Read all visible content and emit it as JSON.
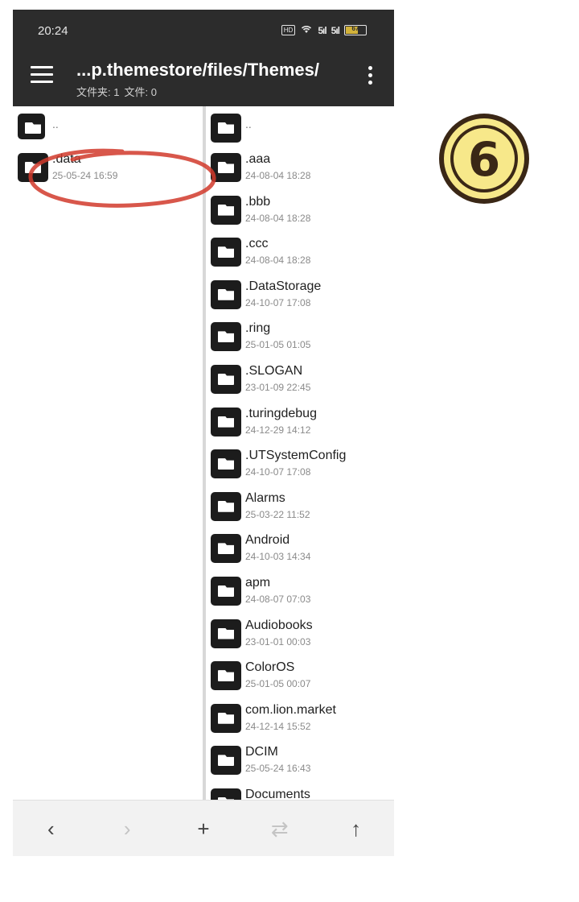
{
  "status_bar": {
    "time": "20:24",
    "hd_label": "HD",
    "wifi_icon": "wifi-icon",
    "signal_1": "5ıl",
    "signal_2": "5ıl",
    "battery_text": "67"
  },
  "toolbar": {
    "title": "...p.themestore/files/Themes/",
    "folders_label": "文件夹: 1",
    "files_label": "文件: 0"
  },
  "left_pane": {
    "items": [
      {
        "name": "..",
        "date": ""
      },
      {
        "name": ".data",
        "date": "25-05-24 16:59"
      }
    ]
  },
  "right_pane": {
    "items": [
      {
        "name": "..",
        "date": ""
      },
      {
        "name": ".aaa",
        "date": "24-08-04 18:28"
      },
      {
        "name": ".bbb",
        "date": "24-08-04 18:28"
      },
      {
        "name": ".ccc",
        "date": "24-08-04 18:28"
      },
      {
        "name": ".DataStorage",
        "date": "24-10-07 17:08"
      },
      {
        "name": ".ring",
        "date": "25-01-05 01:05"
      },
      {
        "name": ".SLOGAN",
        "date": "23-01-09 22:45"
      },
      {
        "name": ".turingdebug",
        "date": "24-12-29 14:12"
      },
      {
        "name": ".UTSystemConfig",
        "date": "24-10-07 17:08"
      },
      {
        "name": "Alarms",
        "date": "25-03-22 11:52"
      },
      {
        "name": "Android",
        "date": "24-10-03 14:34"
      },
      {
        "name": "apm",
        "date": "24-08-07 07:03"
      },
      {
        "name": "Audiobooks",
        "date": "23-01-01 00:03"
      },
      {
        "name": "ColorOS",
        "date": "25-01-05 00:07"
      },
      {
        "name": "com.lion.market",
        "date": "24-12-14 15:52"
      },
      {
        "name": "DCIM",
        "date": "25-05-24 16:43"
      },
      {
        "name": "Documents",
        "date": ""
      }
    ]
  },
  "bottom_bar": {
    "back": "‹",
    "forward": "›",
    "add": "+",
    "swap": "⇄",
    "up": "↑"
  },
  "step_badge": {
    "number": "6"
  },
  "colors": {
    "appbar": "#2c2c2c",
    "annotation": "#d13a2c",
    "badge_fill": "#f7e88a",
    "badge_dark": "#3a2716"
  }
}
